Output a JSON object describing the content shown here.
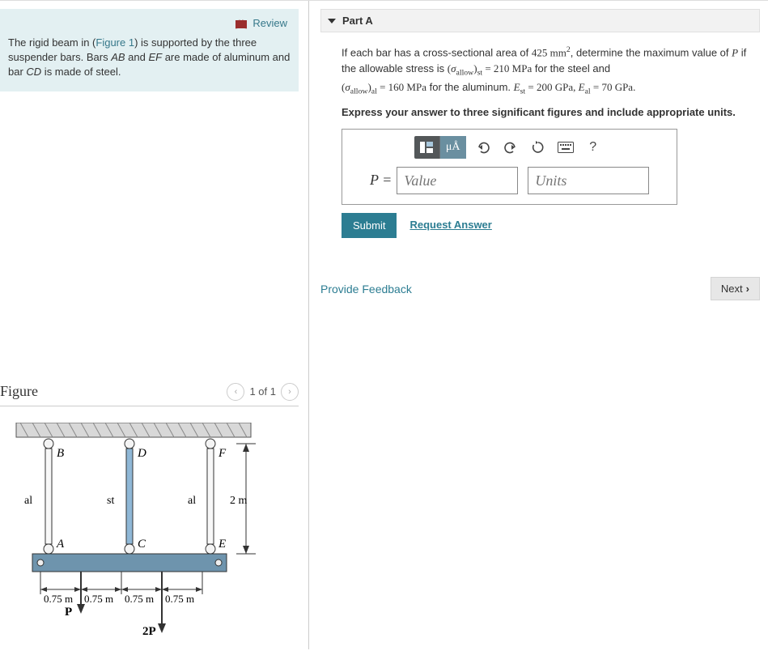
{
  "left": {
    "review_label": "Review",
    "intro_html_pre": "The rigid beam in (",
    "figure_link": "Figure 1",
    "intro_html_post": ") is supported by the three suspender bars. Bars ",
    "bar_ab": "AB",
    "intro_mid1": " and ",
    "bar_ef": "EF",
    "intro_mid2": " are made of aluminum and bar ",
    "bar_cd": "CD",
    "intro_end": " is made of steel."
  },
  "figure": {
    "title": "Figure",
    "nav": "1 of 1",
    "labels": {
      "B": "B",
      "D": "D",
      "F": "F",
      "A": "A",
      "C": "C",
      "E": "E",
      "al": "al",
      "st": "st",
      "h": "2 m",
      "d1": "0.75 m",
      "d2": "0.75 m",
      "d3": "0.75 m",
      "d4": "0.75 m",
      "P": "P",
      "P2": "2P"
    }
  },
  "partA": {
    "header": "Part A",
    "line1a": "If each bar has a cross-sectional area of ",
    "area_val": "425",
    "area_unit_base": "mm",
    "area_unit_exp": "2",
    "line1b": ", determine the maximum value of ",
    "Psym": "P",
    "line1c": " if the allowable stress is ",
    "sig_allow_st_lhs": "(σ",
    "sig_allow_sub": "allow",
    "sig_st_sub": "st",
    "eq": " = ",
    "sig_st_val": "210 MPa",
    "line1d": " for the steel and",
    "sig_al_sub": "al",
    "sig_al_val": "160 MPa",
    "line2b": " for the aluminum. ",
    "Est_lhs": "E",
    "Est_sub": "st",
    "Est_val": "200 GPa",
    "comma": ", ",
    "Eal_lhs": "E",
    "Eal_sub": "al",
    "Eal_val": "70 GPa",
    "period": ".",
    "instruct": "Express your answer to three significant figures and include appropriate units.",
    "P_label": "P =",
    "value_ph": "Value",
    "units_ph": "Units",
    "muA": "μÅ",
    "qmark": "?",
    "submit": "Submit",
    "request": "Request Answer"
  },
  "footer": {
    "provide": "Provide Feedback",
    "next": "Next"
  }
}
